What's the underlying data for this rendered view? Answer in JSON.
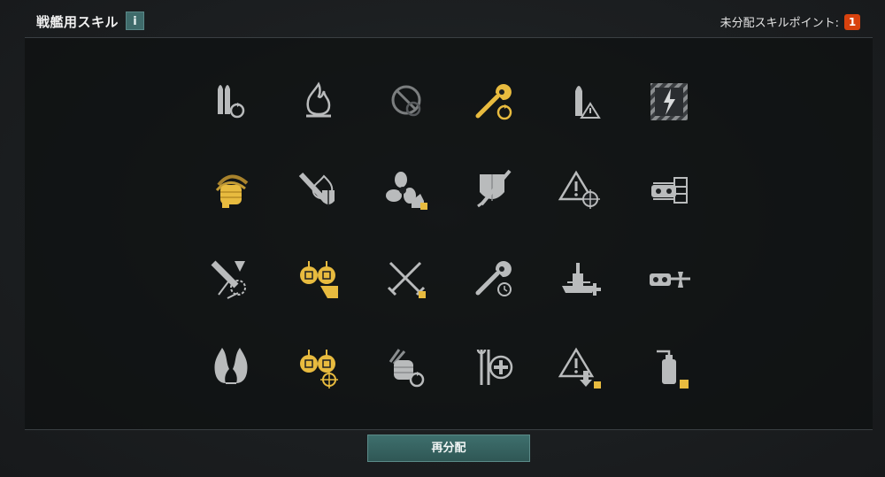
{
  "header": {
    "title": "戦艦用スキル",
    "info_label": "i",
    "points_label": "未分配スキルポイント:",
    "points_value": "1"
  },
  "footer": {
    "reset_label": "再分配"
  },
  "colors": {
    "gold": "#e8bb3f",
    "grey": "#b9bbbc",
    "badge": "#d8420e",
    "button": "#3e6f6d"
  },
  "skills": [
    {
      "icon": "shells-reload-icon",
      "state": "default"
    },
    {
      "icon": "fire-icon",
      "state": "default"
    },
    {
      "icon": "no-entry-icon",
      "state": "dim"
    },
    {
      "icon": "wrench-repair-icon",
      "state": "selected"
    },
    {
      "icon": "shell-warning-icon",
      "state": "default"
    },
    {
      "icon": "lightning-hazard-icon",
      "state": "default"
    },
    {
      "icon": "grenade-throw-icon",
      "state": "selected"
    },
    {
      "icon": "shell-fire-shield-icon",
      "state": "default"
    },
    {
      "icon": "propeller-icon",
      "state": "default"
    },
    {
      "icon": "shield-sword-icon",
      "state": "default"
    },
    {
      "icon": "warning-crosshair-icon",
      "state": "default"
    },
    {
      "icon": "turret-armor-icon",
      "state": "default"
    },
    {
      "icon": "shell-explosion-icon",
      "state": "default"
    },
    {
      "icon": "secondary-guns-icon",
      "state": "selected"
    },
    {
      "icon": "crossed-swords-icon",
      "state": "default"
    },
    {
      "icon": "wrench-timer-icon",
      "state": "default"
    },
    {
      "icon": "battleship-heal-icon",
      "state": "default"
    },
    {
      "icon": "turret-aircraft-icon",
      "state": "default"
    },
    {
      "icon": "fire-flames-icon",
      "state": "default"
    },
    {
      "icon": "secondary-guns-crosshair-icon",
      "state": "selected"
    },
    {
      "icon": "grenade-reload-icon",
      "state": "default"
    },
    {
      "icon": "tools-heal-icon",
      "state": "default"
    },
    {
      "icon": "warning-down-icon",
      "state": "default"
    },
    {
      "icon": "extinguisher-icon",
      "state": "default"
    }
  ]
}
